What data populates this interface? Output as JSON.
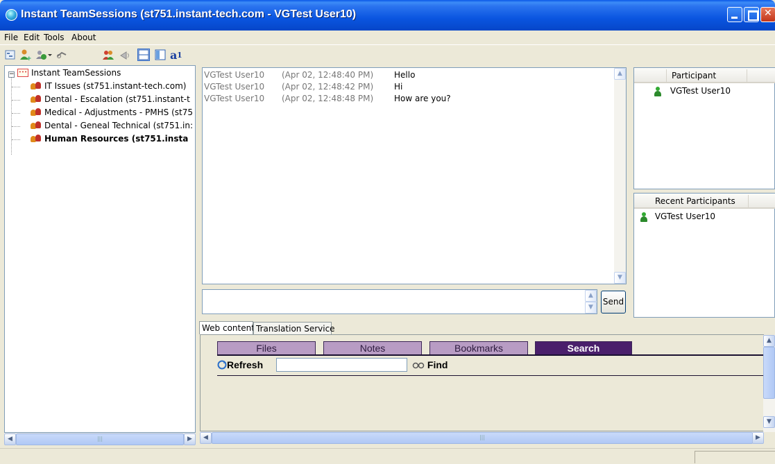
{
  "window": {
    "title": "Instant TeamSessions (st751.instant-tech.com - VGTest User10)"
  },
  "menu": {
    "items": [
      "File",
      "Edit",
      "Tools",
      "About"
    ]
  },
  "toolbar": {
    "icons": [
      "tree-view-icon",
      "add-user-icon",
      "add-group-icon",
      "dropdown-arrow-icon",
      "link-icon",
      "users-icon",
      "broadcast-icon",
      "layout-horizontal-icon",
      "layout-vertical-icon",
      "font-icon"
    ]
  },
  "tree": {
    "root": "Instant TeamSessions",
    "items": [
      "IT Issues (st751.instant-tech.com)",
      "Dental - Escalation (st751.instant-t",
      "Medical - Adjustments - PMHS (st75",
      "Dental - Geneal Technical (st751.in:",
      "Human Resources (st751.insta"
    ]
  },
  "chat": {
    "messages": [
      {
        "sender": "VGTest User10",
        "time": "(Apr 02, 12:48:40 PM)",
        "text": "Hello"
      },
      {
        "sender": "VGTest User10",
        "time": "(Apr 02, 12:48:42 PM)",
        "text": "Hi"
      },
      {
        "sender": "VGTest User10",
        "time": "(Apr 02, 12:48:48 PM)",
        "text": "How are you?"
      }
    ],
    "input_value": "",
    "send_label": "Send"
  },
  "participants": {
    "header": "Participant",
    "items": [
      "VGTest User10"
    ]
  },
  "recent": {
    "header": "Recent Participants",
    "items": [
      "VGTest User10"
    ]
  },
  "tabs": [
    "Web content",
    "Translation Service"
  ],
  "web": {
    "tabs": [
      "Files",
      "Notes",
      "Bookmarks",
      "Search"
    ],
    "active_tab": "Search",
    "refresh_label": "Refresh",
    "find_label": "Find",
    "find_value": ""
  },
  "colors": {
    "titlebar": "#0a55e0",
    "web_tab": "#b89cc4",
    "web_tab_active": "#4a1f6b"
  }
}
